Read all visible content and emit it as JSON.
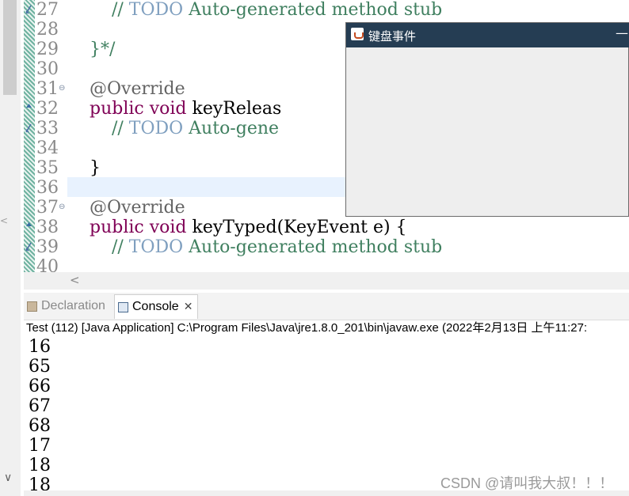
{
  "editor": {
    "lines": [
      {
        "no": "27",
        "fold": "",
        "mark": "task",
        "code": [
          {
            "t": "        "
          },
          {
            "t": "// ",
            "c": "cm"
          },
          {
            "t": "TODO",
            "c": "todo"
          },
          {
            "t": " Auto-generated method stub",
            "c": "cm"
          }
        ]
      },
      {
        "no": "28",
        "fold": "",
        "mark": "",
        "code": []
      },
      {
        "no": "29",
        "fold": "",
        "mark": "",
        "code": [
          {
            "t": "    }*/",
            "c": "cm"
          }
        ]
      },
      {
        "no": "30",
        "fold": "",
        "mark": "",
        "code": []
      },
      {
        "no": "31",
        "fold": "⊖",
        "mark": "",
        "code": [
          {
            "t": "    "
          },
          {
            "t": "@Override",
            "c": "ann"
          }
        ]
      },
      {
        "no": "32",
        "fold": "",
        "mark": "override",
        "code": [
          {
            "t": "    "
          },
          {
            "t": "public",
            "c": "kw"
          },
          {
            "t": " "
          },
          {
            "t": "void",
            "c": "kw"
          },
          {
            "t": " keyReleas"
          }
        ]
      },
      {
        "no": "33",
        "fold": "",
        "mark": "task",
        "code": [
          {
            "t": "        "
          },
          {
            "t": "// ",
            "c": "cm"
          },
          {
            "t": "TODO",
            "c": "todo"
          },
          {
            "t": " Auto-gene",
            "c": "cm"
          }
        ]
      },
      {
        "no": "34",
        "fold": "",
        "mark": "",
        "code": []
      },
      {
        "no": "35",
        "fold": "",
        "mark": "",
        "code": [
          {
            "t": "    }"
          }
        ]
      },
      {
        "no": "36",
        "fold": "",
        "mark": "",
        "code": []
      },
      {
        "no": "37",
        "fold": "⊖",
        "mark": "",
        "code": [
          {
            "t": "    "
          },
          {
            "t": "@Override",
            "c": "ann"
          }
        ]
      },
      {
        "no": "38",
        "fold": "",
        "mark": "override",
        "code": [
          {
            "t": "    "
          },
          {
            "t": "public",
            "c": "kw"
          },
          {
            "t": " "
          },
          {
            "t": "void",
            "c": "kw"
          },
          {
            "t": " keyTyped(KeyEvent e) {"
          }
        ]
      },
      {
        "no": "39",
        "fold": "",
        "mark": "task",
        "code": [
          {
            "t": "        "
          },
          {
            "t": "// ",
            "c": "cm"
          },
          {
            "t": "TODO",
            "c": "todo"
          },
          {
            "t": " Auto-generated method stub",
            "c": "cm"
          }
        ]
      },
      {
        "no": "40",
        "fold": "",
        "mark": "",
        "code": []
      }
    ],
    "hscroll_arrow": "<"
  },
  "views": {
    "tabs": [
      {
        "label": "Declaration",
        "active": false
      },
      {
        "label": "Console",
        "active": true
      }
    ],
    "close_glyph": "✕"
  },
  "console": {
    "path": "Test (112) [Java Application] C:\\Program Files\\Java\\jre1.8.0_201\\bin\\javaw.exe (2022年2月13日 上午11:27:",
    "output": [
      "16",
      "65",
      "66",
      "67",
      "68",
      "17",
      "18",
      "18"
    ]
  },
  "frame": {
    "title": "键盘事件",
    "minimize": "—"
  },
  "scrollbar": {
    "down_arrow": "∨",
    "mid_glyph": "<"
  },
  "watermark": "CSDN @请叫我大叔！！！",
  "colors": {
    "keyword": "#7f0055",
    "annotation": "#646464",
    "comment": "#3f7f5f",
    "todo": "#7f9fbf",
    "titlebar": "#253d53",
    "current_line": "#e8f2fe"
  },
  "icons": {
    "frame": "java-cup-icon",
    "declaration_tab": "declaration-icon",
    "console_tab": "console-icon"
  }
}
